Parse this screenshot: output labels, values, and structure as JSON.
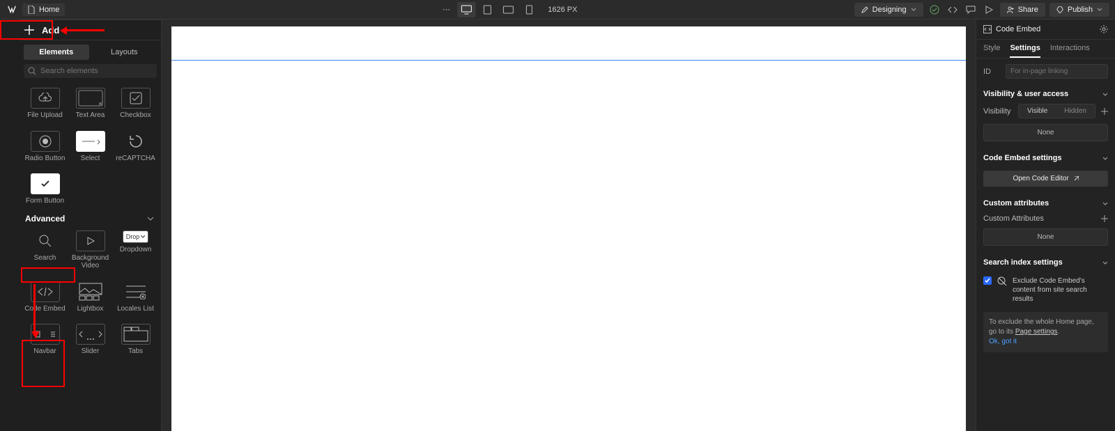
{
  "topbar": {
    "page_name": "Home",
    "zoom": "1626 PX",
    "mode": "Designing",
    "share": "Share",
    "publish": "Publish"
  },
  "add_panel": {
    "title": "Add",
    "tabs": {
      "elements": "Elements",
      "layouts": "Layouts"
    },
    "search_placeholder": "Search elements",
    "forms_items": [
      {
        "name": "File Upload"
      },
      {
        "name": "Text Area"
      },
      {
        "name": "Checkbox"
      },
      {
        "name": "Radio Button"
      },
      {
        "name": "Select"
      },
      {
        "name": "reCAPTCHA"
      },
      {
        "name": "Form Button"
      }
    ],
    "advanced_header": "Advanced",
    "advanced_items_row1": [
      {
        "name": "Search"
      },
      {
        "name": "Background Video"
      },
      {
        "name": "Dropdown",
        "pill": "Drop"
      }
    ],
    "advanced_items_row2": [
      {
        "name": "Code Embed"
      },
      {
        "name": "Lightbox"
      },
      {
        "name": "Locales List"
      }
    ],
    "advanced_items_row3": [
      {
        "name": "Navbar"
      },
      {
        "name": "Slider"
      },
      {
        "name": "Tabs"
      }
    ]
  },
  "inspector": {
    "title": "Code Embed",
    "tabs": {
      "style": "Style",
      "settings": "Settings",
      "interactions": "Interactions"
    },
    "id_label": "ID",
    "id_placeholder": "For in-page linking",
    "visibility_section": "Visibility & user access",
    "visibility_label": "Visibility",
    "visible": "Visible",
    "hidden": "Hidden",
    "none": "None",
    "code_embed_section": "Code Embed settings",
    "open_editor": "Open Code Editor",
    "custom_attr_section": "Custom attributes",
    "custom_attr_label": "Custom Attributes",
    "search_index_section": "Search index settings",
    "exclude_label": "Exclude Code Embed's content from site search results",
    "help_text_pre": "To exclude the whole Home page, go to its ",
    "help_link_text": "Page settings",
    "help_text_post": ".",
    "ok_got_it": "Ok, got it"
  }
}
